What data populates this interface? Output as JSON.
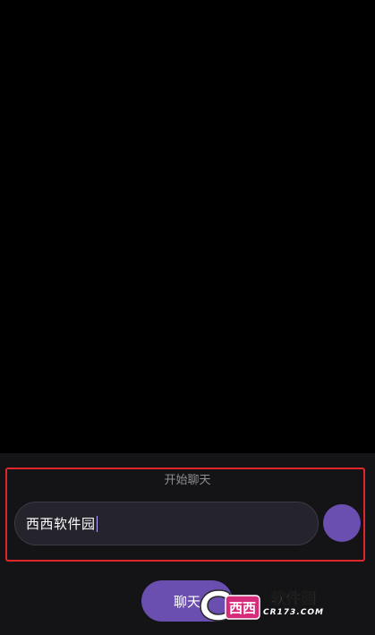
{
  "chat": {
    "start_label": "开始聊天"
  },
  "input": {
    "value": "西西软件园"
  },
  "bottom_button": {
    "label": "聊天"
  },
  "watermark": {
    "logo_text": "西西",
    "title": "软件园",
    "subtitle": "CR173.COM"
  },
  "colors": {
    "accent": "#6a4fb0",
    "highlight_border": "#e0262b",
    "panel_bg": "#141416",
    "input_bg": "#25232b"
  }
}
